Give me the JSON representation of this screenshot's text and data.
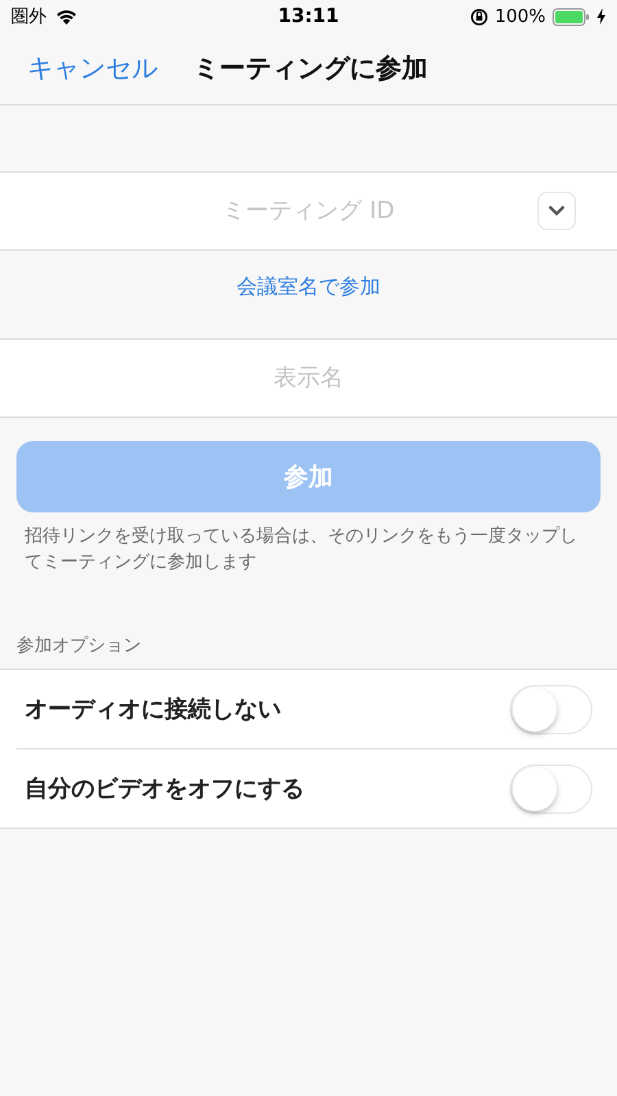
{
  "status_bar": {
    "carrier": "圏外",
    "time": "13:11",
    "battery": "100%"
  },
  "nav": {
    "cancel": "キャンセル",
    "title": "ミーティングに参加"
  },
  "meeting_id": {
    "placeholder": "ミーティング ID"
  },
  "room_link": "会議室名で参加",
  "display_name": {
    "placeholder": "表示名"
  },
  "join_button": {
    "label": "参加",
    "disabled": true
  },
  "hint": "招待リンクを受け取っている場合は、そのリンクをもう一度タップしてミーティングに参加します",
  "options": {
    "title": "参加オプション",
    "items": [
      {
        "label": "オーディオに接続しない",
        "on": false
      },
      {
        "label": "自分のビデオをオフにする",
        "on": false
      }
    ]
  }
}
